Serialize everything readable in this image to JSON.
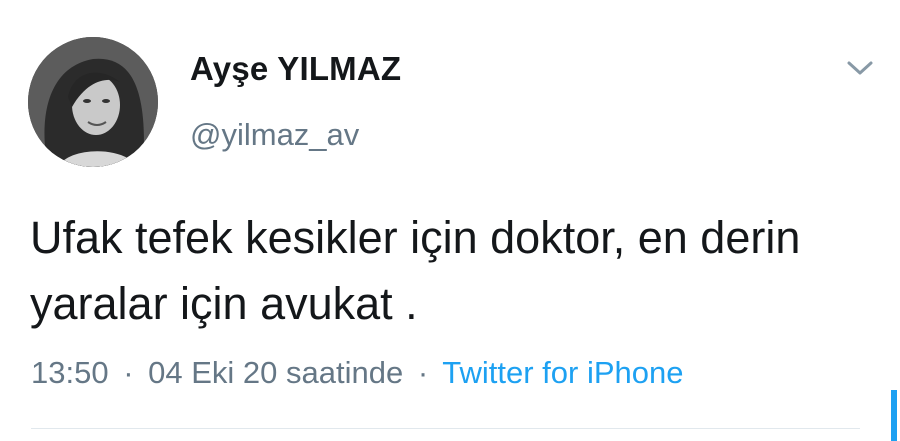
{
  "tweet": {
    "author": {
      "display_name": "Ayşe YILMAZ",
      "handle": "@yilmaz_av"
    },
    "text": "Ufak tefek kesikler için doktor, en derin yaralar için avukat .",
    "meta": {
      "time": "13:50",
      "separator": "·",
      "date": "04 Eki 20 saatinde",
      "source": "Twitter for iPhone"
    },
    "icons": {
      "menu": "chevron-down-icon"
    }
  },
  "colors": {
    "text_primary": "#14171a",
    "text_secondary": "#657786",
    "accent": "#1da1f2",
    "divider": "#e1e8ed"
  }
}
